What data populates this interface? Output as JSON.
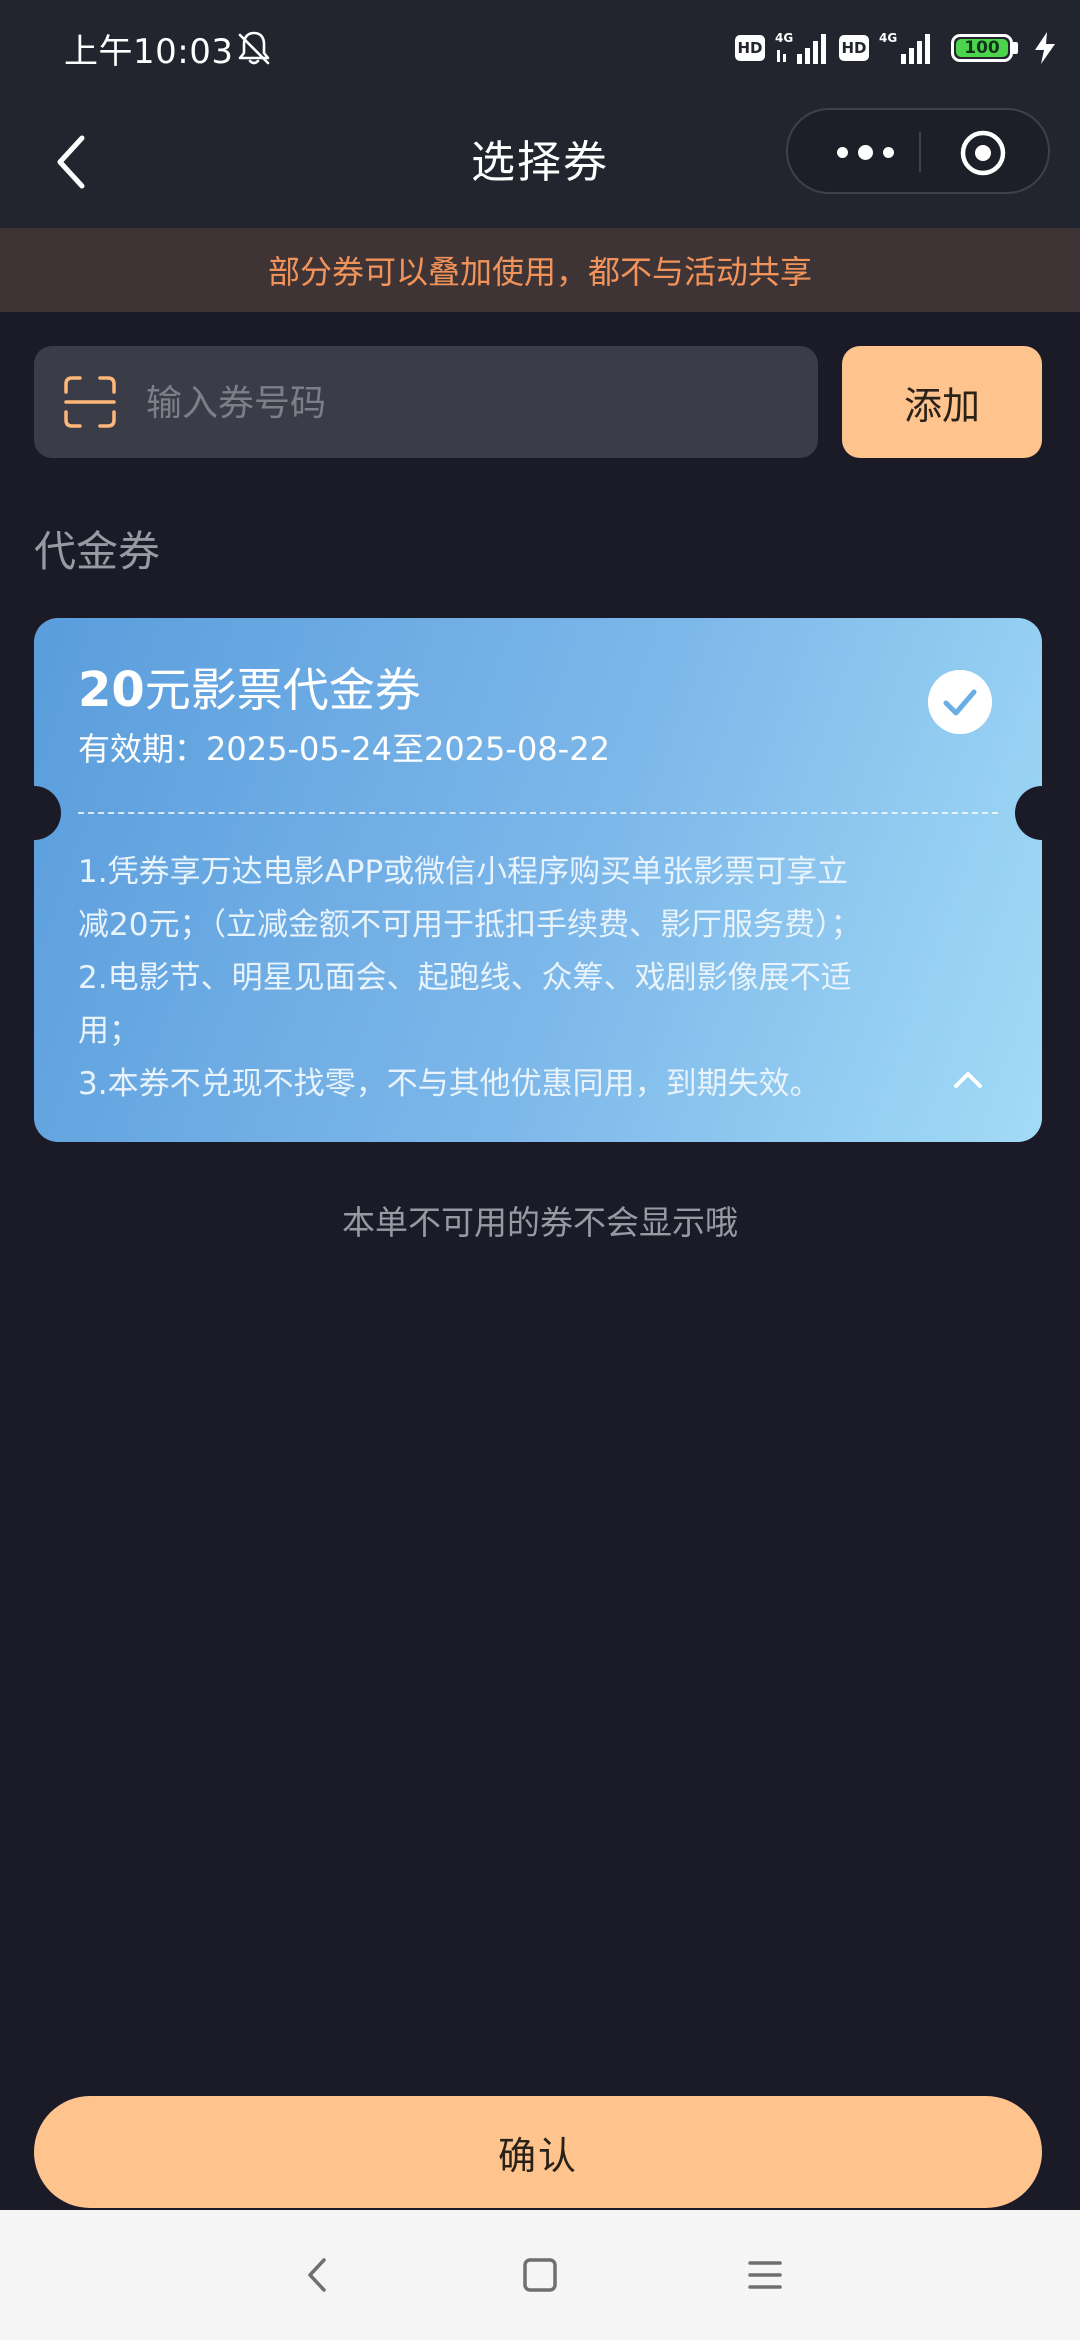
{
  "status_bar": {
    "time": "上午10:03",
    "hd_1": "HD",
    "network_1": "4G",
    "hd_2": "HD",
    "network_2": "4G",
    "battery": "100"
  },
  "nav": {
    "title": "选择券"
  },
  "notice": {
    "text": "部分券可以叠加使用，都不与活动共享"
  },
  "code_entry": {
    "placeholder": "输入券号码",
    "value": "",
    "add_label": "添加"
  },
  "section": {
    "title": "代金券"
  },
  "coupon": {
    "amount": "20",
    "title_rest": "元影票代金券",
    "validity": "有效期：2025-05-24至2025-08-22",
    "selected": true,
    "rules": [
      "1.凭券享万达电影APP或微信小程序购买单张影票可享立",
      "减20元；（立减金额不可用于抵扣手续费、影厅服务费）；",
      "2.电影节、明星见面会、起跑线、众筹、戏剧影像展不适",
      "用；",
      "3.本券不兑现不找零，不与其他优惠同用，到期失效。"
    ]
  },
  "hint": {
    "text": "本单不可用的券不会显示哦"
  },
  "footer": {
    "confirm_label": "确认"
  },
  "colors": {
    "background": "#1a1b27",
    "bar": "#22242e",
    "accent": "#ffc48e",
    "notice_text": "#f2945a",
    "coupon_start": "#5a9ddc",
    "coupon_end": "#a2dbf6"
  },
  "icons": {
    "bell": "bell-off-icon",
    "back": "chevron-left-icon",
    "more": "more-dots-icon",
    "close": "target-close-icon",
    "scan": "scan-icon",
    "check": "check-circle-icon",
    "collapse": "chevron-up-icon"
  }
}
